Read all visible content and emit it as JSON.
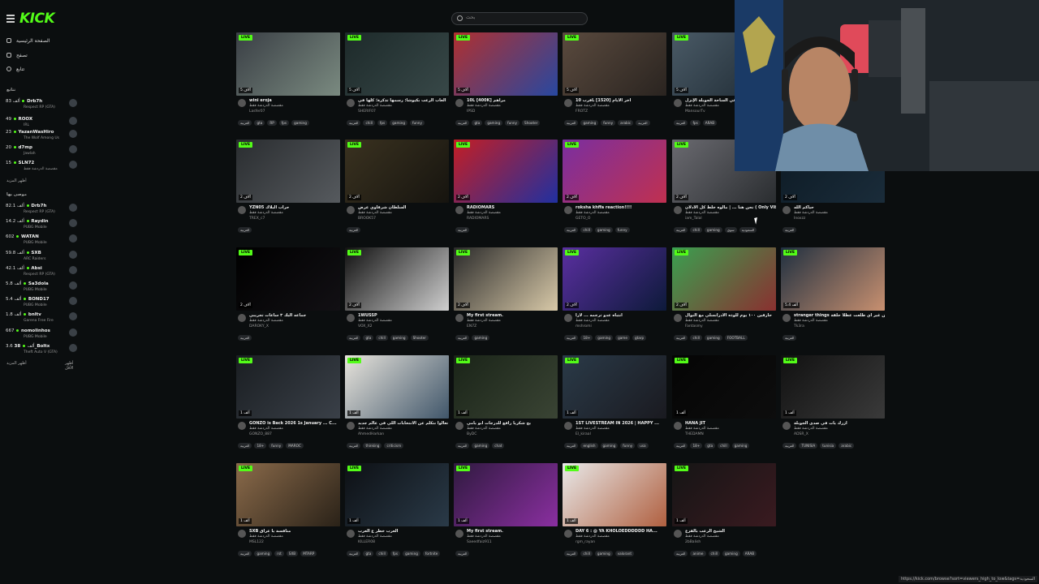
{
  "header": {
    "logo": "KICK",
    "search_placeholder": "بحث"
  },
  "sidebar": {
    "nav": [
      "الصفحة الرئيسية",
      "تصفح",
      "تتابع"
    ],
    "following_title": "تتابع",
    "following": [
      {
        "viewers": "83 ألف",
        "name": "Drb7h",
        "game": "Respect RP (GTA)"
      },
      {
        "viewers": "49",
        "name": "ROOX",
        "game": "IRL"
      },
      {
        "viewers": "23",
        "name": "YazanWasHiro",
        "game": "The Wolf Among Us"
      },
      {
        "viewers": "20",
        "name": "d7mp",
        "game": "Jawlah"
      },
      {
        "viewers": "15",
        "name": "SLN72",
        "game": "مقصصة الدردشة فقط"
      }
    ],
    "following_more": "أظهر المزيد",
    "recommended_title": "موصى بها",
    "recommended": [
      {
        "viewers": "82.1 ألف",
        "name": "Drb7h",
        "game": "Respect RP (GTA)"
      },
      {
        "viewers": "14.2 ألف",
        "name": "Raydin",
        "game": "PUBG Mobile"
      },
      {
        "viewers": "602",
        "name": "WATAN",
        "game": "PUBG Mobile"
      },
      {
        "viewers": "59.8 ألف",
        "name": "SXB",
        "game": "ARC Raiders"
      },
      {
        "viewers": "42.1 ألف",
        "name": "Absi",
        "game": "Respect RP (GTA)"
      },
      {
        "viewers": "5.8 ألف",
        "name": "Sa3dola",
        "game": "PUBG Mobile"
      },
      {
        "viewers": "5.4 ألف",
        "name": "BOND17",
        "game": "PUBG Mobile"
      },
      {
        "viewers": "1.8 ألف",
        "name": "bnltv",
        "game": "Garena Free Fire"
      },
      {
        "viewers": "667",
        "name": "nomolinhos",
        "game": "PUBG Mobile"
      },
      {
        "viewers": "3.6 ألف",
        "name": "38_Boltx",
        "game": "Theft Auto V (GTA)"
      }
    ],
    "recommended_more": [
      "أظهر المزيد",
      "أظهر الأقل"
    ]
  },
  "cards": [
    {
      "title": "wini eroja",
      "category": "مقصصة الدردشة فقط",
      "streamer": "Lasfer07",
      "viewers": "5 آلاف",
      "tags": [
        "العربية",
        "gta",
        "RP",
        "fps",
        "gaming"
      ]
    },
    {
      "title": "ألعاب الرعب بكيوشا: رسمها تذكرة؛ كلها في",
      "category": "مقصصة الدردشة فقط",
      "streamer": "SHERIF07",
      "viewers": "5 آلاف",
      "tags": [
        "العربية",
        "chill",
        "fps",
        "gaming",
        "funny"
      ]
    },
    {
      "title": "10L [400K] مراهم",
      "category": "مقصصة الدردشة فقط",
      "streamer": "IPSD",
      "viewers": "5 آلاف",
      "tags": [
        "العربية",
        "gta",
        "gaming",
        "funny",
        "Shooter"
      ]
    },
    {
      "title": "فرب 10L [1520] آخر الأيام",
      "category": "مقصصة الدردشة فقط",
      "streamer": "FROTZ",
      "viewers": "5 آلاف",
      "tags": [
        "العربية",
        "gaming",
        "funny",
        "arabic",
        "العربية"
      ]
    },
    {
      "title": "ألرك بقيت في الساحة الجوبلة الإنزل",
      "category": "مقصصة الدردشة فقط",
      "streamer": "MansourTv",
      "viewers": "5 آلاف",
      "tags": [
        "العربية",
        "fps",
        "ARAB"
      ]
    },
    {
      "title": "YZN05 حراب البلاك",
      "category": "مقصصة الدردشة فقط",
      "streamer": "TREX_c7",
      "viewers": "2 آلاف",
      "tags": [
        "العربية"
      ]
    },
    {
      "title": "السلطان شرقاوي عرض",
      "category": "مقصصة الدردشة فقط",
      "streamer": "BROOK57",
      "viewers": "2 آلاف",
      "tags": [
        "العربية"
      ]
    },
    {
      "title": "RADIOMARS",
      "category": "مقصصة الدردشة فقط",
      "streamer": "RADIOMARS",
      "viewers": "2 آلاف",
      "tags": [
        "العربية"
      ]
    },
    {
      "title": "roksha khffa reaction!!!!",
      "category": "مقصصة الدردشة فقط",
      "streamer": "GETO_O",
      "viewers": "2 آلاف",
      "tags": [
        "العربية",
        "chill",
        "gaming",
        "funny"
      ]
    },
    {
      "title": "نحن هنا ... | مالوه خلط كل الأدلان ( Only Vibes )",
      "category": "مقصصة الدردشة فقط",
      "streamer": "iam_Talal",
      "viewers": "2 آلاف",
      "tags": [
        "العربية",
        "chill",
        "gaming",
        "سوي",
        "السعودية"
      ]
    },
    {
      "title": "حياكم الله",
      "category": "مقصصة الدردشة فقط",
      "streamer": "Inoxzz",
      "viewers": "2 آلاف",
      "tags": [
        "العربية"
      ]
    },
    {
      "title": "جماعه البك ٣ ساعات تجريبي",
      "category": "مقصصة الدردشة فقط",
      "streamer": "DAROKY_X",
      "viewers": "2 آلاف",
      "tags": [
        "العربية"
      ]
    },
    {
      "title": "1WUSSP",
      "category": "مقصصة الدردشة فقط",
      "streamer": "VOX_X2",
      "viewers": "2 آلاف",
      "tags": [
        "العربية",
        "gta",
        "chill",
        "gaming",
        "Shooter"
      ]
    },
    {
      "title": "My first stream.",
      "category": "مقصصة الدردشة فقط",
      "streamer": "EN7Z",
      "viewers": "2 آلاف",
      "tags": [
        "العربية",
        "gaming"
      ]
    },
    {
      "title": "انتباه عدو ترجمه ... لارا",
      "category": "مقصصة الدردشة فقط",
      "streamer": "mshromi",
      "viewers": "2 آلاف",
      "tags": [
        "العربية",
        "18+",
        "gaming",
        "game",
        "gtarp"
      ]
    },
    {
      "title": "حارقين ١٠٠ يوم للوذه الادرانسلي مع النوال",
      "category": "مقصصة الدردشة فقط",
      "streamer": "Fantasmy",
      "viewers": "2 آلاف",
      "tags": [
        "العربية",
        "chill",
        "gaming",
        "FOOTBALL"
      ]
    },
    {
      "title": "stranger things من غير أي طلعت عظلا حلقة",
      "category": "مقصصة الدردشة فقط",
      "streamer": "Tk3ra",
      "viewers": "5.4 ألف",
      "tags": [
        "العربية"
      ]
    },
    {
      "title": "GONZO is Back 2026 1s January ... C...",
      "category": "مقصصة الدردشة فقط",
      "streamer": "GONZO_887",
      "viewers": "1 ألف",
      "tags": [
        "العربية",
        "18+",
        "funny",
        "MAROC"
      ]
    },
    {
      "title": "تعالوا نتكلم عن الانتخابات اللي في عالم جديد",
      "category": "مقصصة الدردشة فقط",
      "streamer": "AhmedHarkan",
      "viewers": "1 ألف",
      "tags": [
        "العربية",
        "thinking",
        "criticism"
      ]
    },
    {
      "title": "يح شكرياً رافع للدرجات أبو يامي",
      "category": "مقصصة الدردشة فقط",
      "streamer": "ByDC",
      "viewers": "1 ألف",
      "tags": [
        "العربية",
        "gaming",
        "chat"
      ]
    },
    {
      "title": "1ST LIVESTREAM IN 2026 | HAPPY ...",
      "category": "مقصصة الدردشة فقط",
      "streamer": "El_kiraal",
      "viewers": "1 ألف",
      "tags": [
        "العربية",
        "english",
        "gaming",
        "funny",
        "usa"
      ]
    },
    {
      "title": "HANA JIT",
      "category": "مقصصة الدردشة فقط",
      "streamer": "THEDAMN",
      "viewers": "1 ألف",
      "tags": [
        "العربية",
        "18+",
        "gta",
        "chill",
        "gaming"
      ]
    },
    {
      "title": "أزرك يات في صدى الجوبلة",
      "category": "مقصصة الدردشة فقط",
      "streamer": "ADSR_X",
      "viewers": "1 ألف",
      "tags": [
        "العربية",
        "TUNISIA",
        "tunisia",
        "arabic"
      ]
    },
    {
      "title": "SXB منافسة يا عراق",
      "category": "مقصصة الدردشة فقط",
      "streamer": "MSL122",
      "viewers": "1 ألف",
      "tags": [
        "العربية",
        "gaming",
        "rst",
        "SXB",
        "MTARP"
      ]
    },
    {
      "title": "العرب خطر ع العرب",
      "category": "مقصصة الدردشة فقط",
      "streamer": "KILLER08",
      "viewers": "1 ألف",
      "tags": [
        "العربية",
        "gta",
        "chill",
        "fps",
        "gaming",
        "fortnite"
      ]
    },
    {
      "title": "My first stream.",
      "category": "مقصصة الدردشة فقط",
      "streamer": "Saeedfaiz911",
      "viewers": "1 ألف",
      "tags": [
        "العربية"
      ]
    },
    {
      "title": "DAY 6 : @ YA KHOLOEDDDDDD HA...",
      "category": "مقصصة الدردشة فقط",
      "streamer": "rgm_rayan",
      "viewers": "1 ألف",
      "tags": [
        "العربية",
        "chill",
        "gaming",
        "valorant"
      ]
    },
    {
      "title": "الشيخ الرعب بالفزع",
      "category": "مقصصة الدردشة فقط",
      "streamer": "2bBalish",
      "viewers": "1 ألف",
      "tags": [
        "العربية",
        "anime",
        "chill",
        "gaming",
        "ARAB"
      ]
    }
  ],
  "live_label": "LIVE",
  "status_url": "https://kick.com/browse?sort=viewers_high_to_low&tags=السعودية"
}
